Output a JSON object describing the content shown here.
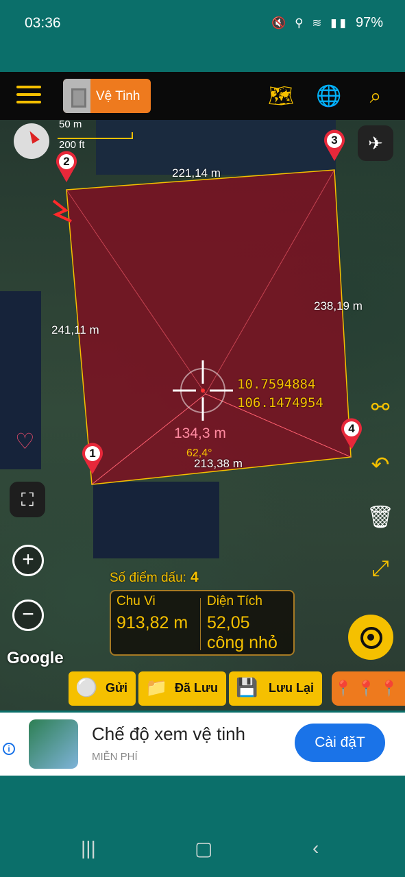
{
  "status": {
    "time": "03:36",
    "battery": "97%",
    "icons": "🔇 ⚲ ≋ ▮▮"
  },
  "toolbar": {
    "layer_label": "Vệ Tinh"
  },
  "map": {
    "scale_m": "50 m",
    "scale_ft": "200 ft",
    "edge_top": "221,14 m",
    "edge_right": "238,19 m",
    "edge_left": "241,11 m",
    "edge_bottom": "213,38 m",
    "lat": "10.7594884",
    "lng": "106.1474954",
    "center_distance": "134,3 m",
    "center_angle": "62,4°",
    "points": [
      "1",
      "2",
      "3",
      "4"
    ],
    "google": "Google",
    "field_color": "#7a1222"
  },
  "summary": {
    "point_count_label": "Số điểm dấu:",
    "point_count": "4",
    "perimeter_label": "Chu Vi",
    "perimeter_value": "913,82 m",
    "area_label": "Diện Tích",
    "area_value": "52,05",
    "area_unit": "công nhỏ"
  },
  "actions": {
    "send": "Gửi",
    "saved": "Đã Lưu",
    "save": "Lưu Lại"
  },
  "ad": {
    "title": "Chế độ xem vệ tinh",
    "subtitle": "MIỄN PHÍ",
    "button": "Cài đặT"
  },
  "colors": {
    "accent": "#f5c000",
    "orange": "#ee7a1e",
    "teal": "#0b6f6a",
    "ad_blue": "#1a73e8"
  }
}
